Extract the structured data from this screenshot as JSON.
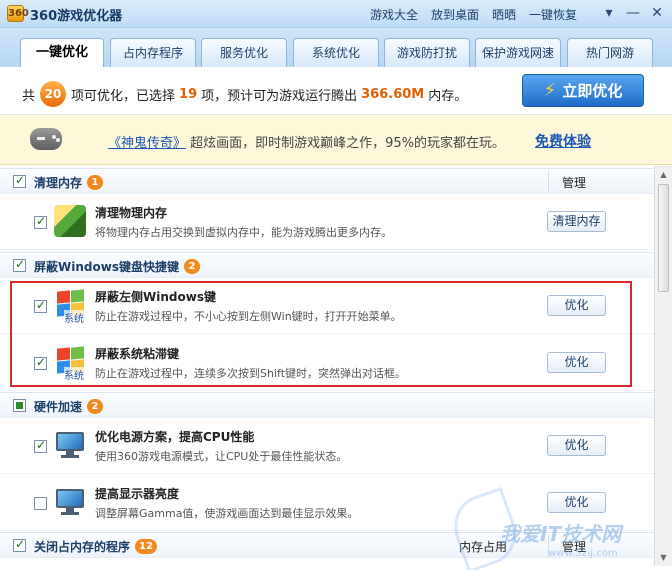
{
  "window": {
    "logo_text": "360",
    "title": "360游戏优化器",
    "links": [
      "游戏大全",
      "放到桌面",
      "晒晒",
      "一键恢复"
    ]
  },
  "tabs": [
    "一键优化",
    "占内存程序",
    "服务优化",
    "系统优化",
    "游戏防打扰",
    "保护游戏网速",
    "热门网游"
  ],
  "summary": {
    "prefix": "共",
    "total": "20",
    "text1": "项可优化，已选择",
    "selected": "19",
    "text2": "项，预计可为游戏运行腾出",
    "memory": "366.60M",
    "text3": "内存。",
    "button_label": "立即优化"
  },
  "promo": {
    "game_link": "《神鬼传奇》",
    "text": "超炫画面，即时制游戏巅峰之作，95%的玩家都在玩。",
    "cta": "免费体验"
  },
  "sections": [
    {
      "title": "清理内存",
      "badge": "1",
      "action": "管理",
      "items": [
        {
          "title": "清理物理内存",
          "desc": "将物理内存占用交换到虚拟内存中，能为游戏腾出更多内存。",
          "button": "清理内存",
          "checked": true
        }
      ]
    },
    {
      "title": "屏蔽Windows键盘快捷键",
      "badge": "2",
      "items": [
        {
          "title": "屏蔽左侧Windows键",
          "desc": "防止在游戏过程中，不小心按到左侧Win键时，打开开始菜单。",
          "button": "优化",
          "checked": true,
          "icon_label": "系统"
        },
        {
          "title": "屏蔽系统粘滞键",
          "desc": "防止在游戏过程中，连续多次按到Shift键时，突然弹出对话框。",
          "button": "优化",
          "checked": true,
          "icon_label": "系统"
        }
      ]
    },
    {
      "title": "硬件加速",
      "badge": "2",
      "items": [
        {
          "title": "优化电源方案，提高CPU性能",
          "desc": "使用360游戏电源模式，让CPU处于最佳性能状态。",
          "button": "优化",
          "checked": true
        },
        {
          "title": "提高显示器亮度",
          "desc": "调整屏幕Gamma值，使游戏画面达到最佳显示效果。",
          "button": "优化",
          "checked": false
        }
      ]
    },
    {
      "title": "关闭占内存的程序",
      "badge": "12",
      "column": "内存占用",
      "action": "管理"
    }
  ],
  "watermark": {
    "text": "我爱IT技术网",
    "sub": "www.52ij.com"
  }
}
